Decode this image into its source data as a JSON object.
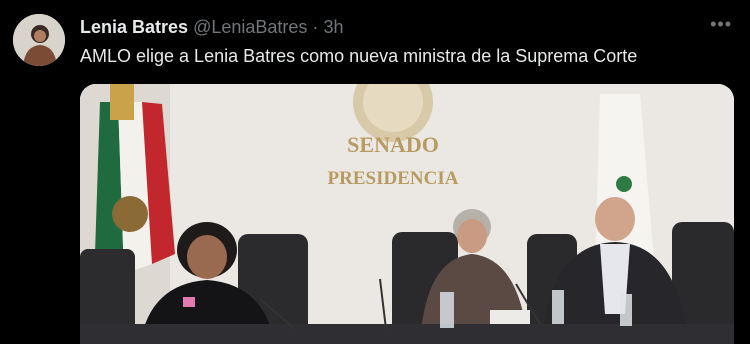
{
  "tweet": {
    "author_name": "Lenia Batres",
    "handle": "@LeniaBatres",
    "separator": "·",
    "time": "3h",
    "more": "•••",
    "text": "AMLO elige a Lenia Batres como nueva ministra de la Suprema Corte"
  },
  "media": {
    "sign_line1": "SENADO",
    "sign_line2": "PRESIDENCIA"
  },
  "colors": {
    "background": "#000000",
    "text": "#e7e9ea",
    "muted": "#71767b"
  }
}
